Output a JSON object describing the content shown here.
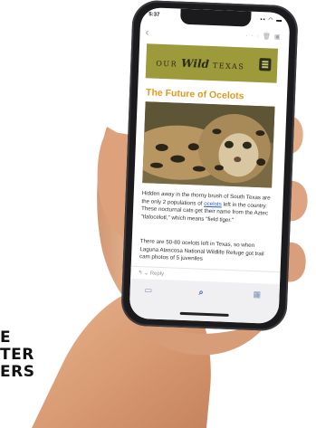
{
  "promo": {
    "lines": [
      "E",
      "TER",
      "ERS"
    ]
  },
  "phone": {
    "status_time": "5:37",
    "status_icons": "▪▪ ◠ ▬"
  },
  "mail": {
    "back_icon": "chevron-left-icon",
    "toolbar_icons": [
      "more-icon",
      "trash-icon",
      "archive-icon"
    ],
    "reply_label": "Reply"
  },
  "newsletter": {
    "brand_left": "OUR",
    "brand_wild": "Wild",
    "brand_right": "TEXAS",
    "headline": "The Future of Ocelots",
    "paragraph1_a": "Hidden away in the thorny brush of South Texas are the only 2 populations of ",
    "paragraph1_link": "ocelots",
    "paragraph1_b": " left in the country. These nocturnal cats get their name from the Aztec \"tlalocelotl,\" which means \"field tiger.\"",
    "paragraph2": "There are 50-80 ocelots left in Texas, so when Laguna Atascosa National Wildlife Refuge got trail cam photos of 5 juveniles"
  },
  "colors": {
    "banner": "#9c9a3a",
    "headline": "#e09b1f",
    "link": "#2a58c7",
    "phone_frame": "#1b1b1e"
  }
}
